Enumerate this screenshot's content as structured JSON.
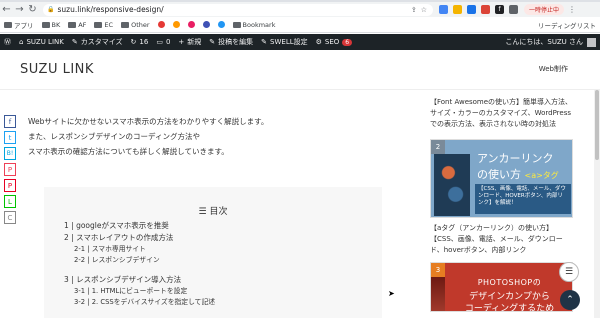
{
  "browser": {
    "url": "suzu.link/responsive-design/",
    "profile_label": "一時停止中",
    "reading_list": "リーディングリスト"
  },
  "bookmarks": [
    "アプリ",
    "BK",
    "AF",
    "EC",
    "Other",
    "Bookmark"
  ],
  "adminbar": {
    "site": "SUZU LINK",
    "customize": "カスタマイズ",
    "updates": "16",
    "comments": "0",
    "new": "新規",
    "edit": "投稿を編集",
    "swell": "SWELL設定",
    "seo": "SEO",
    "seo_badge": "6",
    "greeting": "こんにちは、SUZU さん"
  },
  "header": {
    "logo": "SUZU LINK",
    "nav": "Web制作"
  },
  "share": [
    "f",
    "t",
    "B!",
    "P",
    "P",
    "L",
    "C"
  ],
  "intro": [
    "Webサイトに欠かせないスマホ表示の方法をわかりやすく解説します。",
    "また、レスポンシブデザインのコーディング方法や",
    "スマホ表示の確認方法についても詳しく解説していきます。"
  ],
  "toc": {
    "title": "目次",
    "items": [
      {
        "level": 1,
        "text": "1 | googleがスマホ表示を推奨"
      },
      {
        "level": 1,
        "text": "2 | スマホレイアウトの作成方法"
      },
      {
        "level": 2,
        "text": "2-1 | スマホ専用サイト"
      },
      {
        "level": 2,
        "text": "2-2 | レスポンシブデザイン"
      },
      {
        "level": 0,
        "text": ""
      },
      {
        "level": 1,
        "text": "3 | レスポンシブデザイン導入方法"
      },
      {
        "level": 2,
        "text": "3-1 | 1. HTMLにビューポートを設定"
      },
      {
        "level": 2,
        "text": "3-2 | 2. CSSをデバイスサイズを指定して記述"
      }
    ]
  },
  "sidebar": {
    "card1_title": "【Font Awesomeの使い方】簡単導入方法、サイズ・カラーのカスタマイズ、WordPressでの表示方法、表示されない時の対処法",
    "card2_num": "2",
    "card2_thumb_line1": "アンカーリンク",
    "card2_thumb_line2": "の使い方",
    "card2_thumb_tag": "<a>タグ",
    "card2_thumb_box": "【CSS、画像、電話、メール、ダウンロード、HOVERボタン、内部リンク】を解説！",
    "card2_title": "【aタグ（アンカーリンク）の使い方】【CSS、画像、電話、メール、ダウンロード、hoverボタン、内部リンク",
    "card3_num": "3",
    "card3_thumb_line1": "PHOTOSHOPの",
    "card3_thumb_line2": "デザインカンプから",
    "card3_thumb_line3": "コーディングするため"
  }
}
